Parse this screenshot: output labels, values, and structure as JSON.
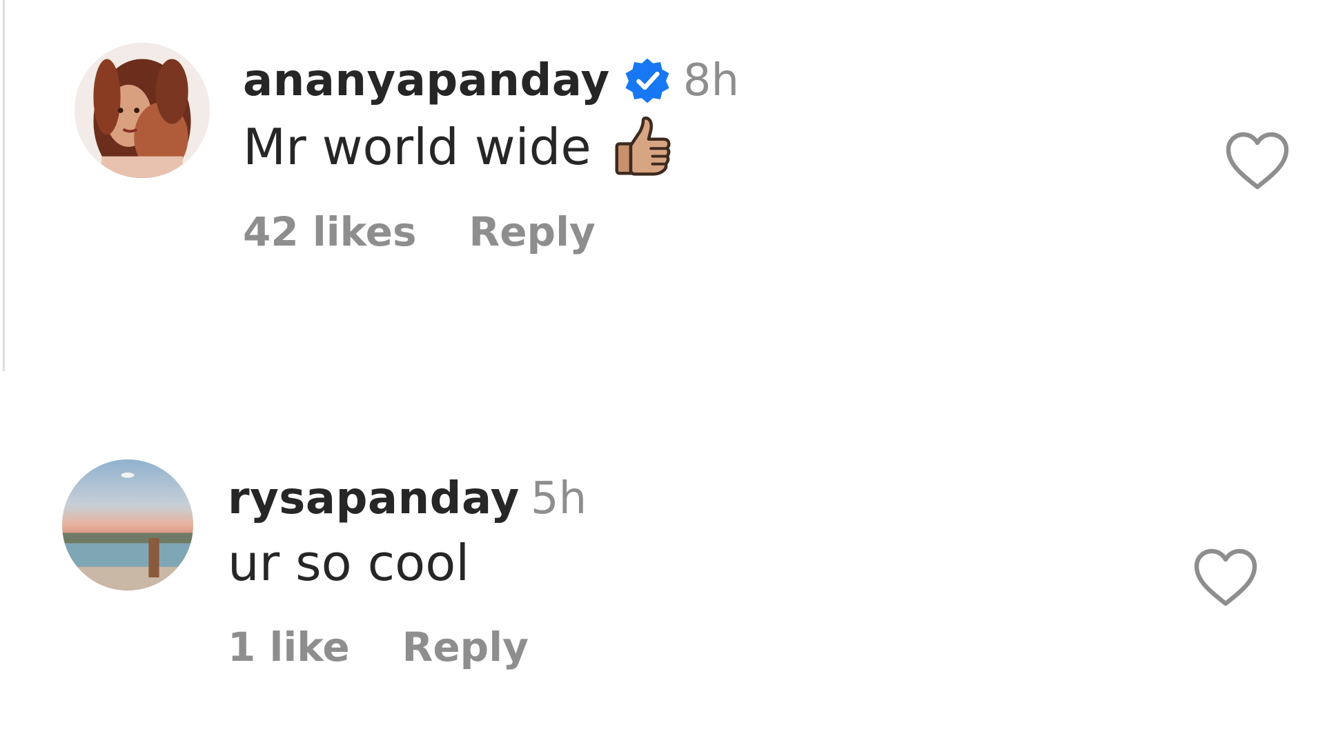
{
  "comments": [
    {
      "username": "ananyapanday",
      "verified": true,
      "time": "8h",
      "text": "Mr world wide",
      "emoji": "thumbs-up-medium-skin-tone",
      "likes": "42 likes",
      "reply": "Reply"
    },
    {
      "username": "rysapanday",
      "verified": false,
      "time": "5h",
      "text": "ur so cool",
      "likes": "1 like",
      "reply": "Reply"
    }
  ],
  "colors": {
    "text": "#262626",
    "secondary": "#8e8e8e",
    "verified": "#1877f2",
    "heart_outline": "#8e8e8e"
  },
  "icons": {
    "verified": "verified-badge-icon",
    "like": "heart-outline-icon"
  }
}
